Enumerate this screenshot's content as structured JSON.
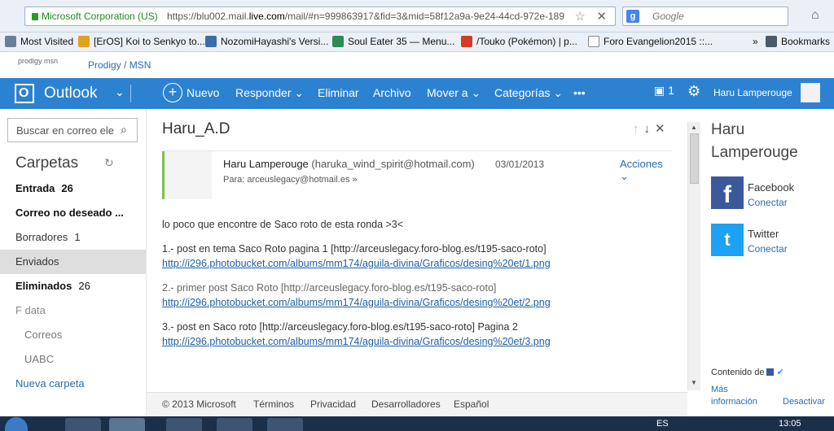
{
  "browser": {
    "identity": "Microsoft Corporation (US)",
    "url_prefix": "https://blu002.mail.",
    "url_domain": "live.com",
    "url_rest": "/mail/#n=999863917&fid=3&mid=58f12a9a-9e24-44cd-972e-189",
    "search_engine": "Google",
    "bookmarks": [
      {
        "label": "Most Visited",
        "icon": "bookmark-folder-icon",
        "color": "#6a7f96"
      },
      {
        "label": "[ErOS] Koi to Senkyo to...",
        "icon": "site-favicon",
        "color": "#e0a020"
      },
      {
        "label": "NozomiHayashi's Versi...",
        "icon": "site-favicon",
        "color": "#3a6ea5"
      },
      {
        "label": "Soul Eater 35 — Menu...",
        "icon": "site-favicon",
        "color": "#2e8b57"
      },
      {
        "label": "/Touko (Pokémon) | p...",
        "icon": "site-favicon",
        "color": "#d23b2a"
      },
      {
        "label": "Foro Evangelion2015 ::...",
        "icon": "page-icon",
        "color": "#ffffff"
      }
    ],
    "bookmarks_overflow": "»",
    "bookmarks_menu": "Bookmarks"
  },
  "portal": {
    "logo": "prodigy msn",
    "link": "Prodigy / MSN"
  },
  "outlook_nav": {
    "app_name": "Outlook",
    "items": [
      "Nuevo",
      "Responder",
      "Eliminar",
      "Archivo",
      "Mover a",
      "Categorías",
      "•••"
    ],
    "message_count": "1",
    "user": "Haru Lamperouge"
  },
  "sidebar": {
    "search_placeholder": "Buscar en correo ele",
    "folders_title": "Carpetas",
    "folders": [
      {
        "label": "Entrada",
        "count": "26",
        "bold": true
      },
      {
        "label": "Correo no deseado ...",
        "count": "",
        "bold": true
      },
      {
        "label": "Borradores",
        "count": "1",
        "bold": false
      },
      {
        "label": "Enviados",
        "count": "",
        "bold": false
      },
      {
        "label": "Eliminados",
        "count": "26",
        "bold": true
      },
      {
        "label": "F data",
        "count": "",
        "bold": false
      },
      {
        "label": "Correos",
        "count": "",
        "bold": false
      },
      {
        "label": "UABC",
        "count": "",
        "bold": false
      }
    ],
    "new_folder": "Nueva carpeta"
  },
  "message": {
    "subject": "Haru_A.D",
    "sender_name": "Haru Lamperouge",
    "sender_email": "(haruka_wind_spirit@hotmail.com)",
    "date": "03/01/2013",
    "actions": "Acciones",
    "to_label": "Para:",
    "to": "arceuslegacy@hotmail.es",
    "intro": "lo poco que encontre de Saco roto de esta ronda >3<",
    "items": [
      {
        "text": "1.- post en tema Saco Roto pagina 1 [http://arceuslegacy.foro-blog.es/t195-saco-roto]",
        "link": "http://i296.photobucket.com/albums/mm174/aguila-divina/Graficos/desing%20et/1.png"
      },
      {
        "text": "2.- primer post Saco Roto [http://arceuslegacy.foro-blog.es/t195-saco-roto]",
        "link": "http://i296.photobucket.com/albums/mm174/aguila-divina/Graficos/desing%20et/2.png"
      },
      {
        "text": "3.- post en Saco roto [http://arceuslegacy.foro-blog.es/t195-saco-roto] Pagina 2",
        "link": "http://i296.photobucket.com/albums/mm174/aguila-divina/Graficos/desing%20et/3.png"
      }
    ]
  },
  "footer": {
    "links": [
      "© 2013 Microsoft",
      "Términos",
      "Privacidad",
      "Desarrolladores",
      "Español"
    ]
  },
  "contact": {
    "name": "Haru Lamperouge",
    "facebook": "Facebook",
    "twitter": "Twitter",
    "connect": "Conectar",
    "content_from": "Contenido de",
    "more_info": "Más información",
    "deactivate": "Desactivar"
  },
  "taskbar": {
    "lang": "ES",
    "time": "13:05"
  },
  "colors": {
    "accent": "#2c82d0",
    "link": "#2b6cb0"
  }
}
